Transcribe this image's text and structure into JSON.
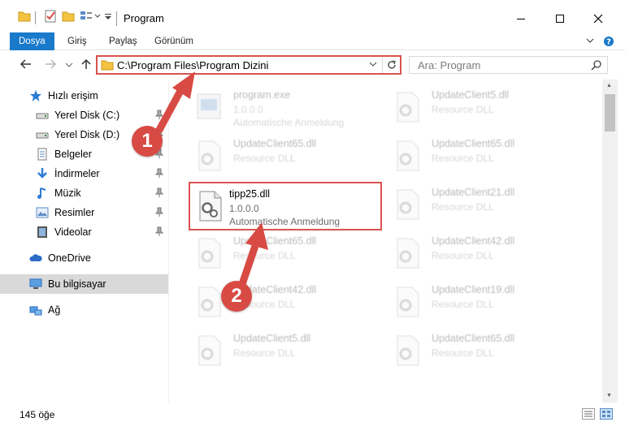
{
  "window": {
    "title": "Program",
    "minimize_icon": "minimize-icon",
    "maximize_icon": "maximize-icon",
    "close_icon": "close-icon"
  },
  "ribbon": {
    "tabs": [
      {
        "label": "Dosya"
      },
      {
        "label": "Giriş"
      },
      {
        "label": "Paylaş"
      },
      {
        "label": "Görünüm"
      }
    ]
  },
  "address_bar": {
    "path": "C:\\Program Files\\Program Dizini"
  },
  "search": {
    "placeholder": "Ara: Program"
  },
  "sidebar": {
    "items": [
      {
        "label": "Hızlı erişim",
        "icon": "star-icon"
      },
      {
        "label": "Yerel Disk (C:)",
        "icon": "drive-icon"
      },
      {
        "label": "Yerel Disk (D:)",
        "icon": "drive-icon"
      },
      {
        "label": "Belgeler",
        "icon": "documents-icon"
      },
      {
        "label": "İndirmeler",
        "icon": "download-icon"
      },
      {
        "label": "Müzik",
        "icon": "music-icon"
      },
      {
        "label": "Resimler",
        "icon": "pictures-icon"
      },
      {
        "label": "Videolar",
        "icon": "videos-icon"
      },
      {
        "label": "OneDrive",
        "icon": "cloud-icon"
      },
      {
        "label": "Bu bilgisayar",
        "icon": "computer-icon"
      },
      {
        "label": "Ağ",
        "icon": "network-icon"
      }
    ]
  },
  "files": [
    {
      "name": "program.exe",
      "version": "1.0.0.0",
      "desc": "Automatische Anmeldung"
    },
    {
      "name": "UpdateClient5.dll",
      "version": "",
      "desc": "Resource DLL"
    },
    {
      "name": "UpdateClient65.dll",
      "version": "",
      "desc": "Resource DLL"
    },
    {
      "name": "UpdateClient65.dll",
      "version": "",
      "desc": "Resource DLL"
    },
    {
      "name": "tipp25.dll",
      "version": "1.0.0.0",
      "desc": "Automatische Anmeldung"
    },
    {
      "name": "UpdateClient21.dll",
      "version": "",
      "desc": "Resource DLL"
    },
    {
      "name": "UpdateClient65.dll",
      "version": "",
      "desc": "Resource DLL"
    },
    {
      "name": "UpdateClient42.dll",
      "version": "",
      "desc": "Resource DLL"
    },
    {
      "name": "UpdateClient42.dll",
      "version": "",
      "desc": "Resource DLL"
    },
    {
      "name": "UpdateClient19.dll",
      "version": "",
      "desc": "Resource DLL"
    },
    {
      "name": "UpdateClient5.dll",
      "version": "",
      "desc": "Resource DLL"
    },
    {
      "name": "UpdateClient65.dll",
      "version": "",
      "desc": "Resource DLL"
    }
  ],
  "status": {
    "item_count": "145 öğe"
  },
  "annotations": {
    "badge1": "1",
    "badge2": "2",
    "color": "#d84b44"
  },
  "colors": {
    "accent": "#1979ca",
    "highlight": "#d9534f",
    "folder": "#f5c342"
  }
}
